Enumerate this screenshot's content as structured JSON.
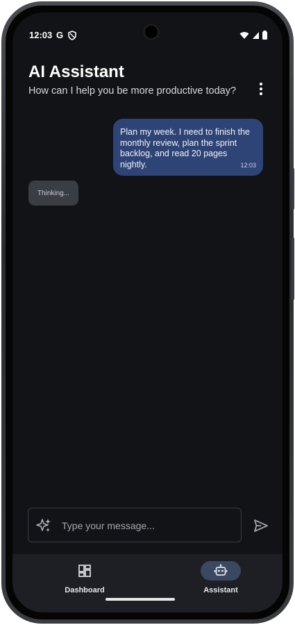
{
  "status_bar": {
    "time": "12:03",
    "google_glyph": "G"
  },
  "header": {
    "title": "AI Assistant",
    "subtitle": "How can I help you be more productive today?",
    "menu_icon": "more-vert-icon"
  },
  "messages": [
    {
      "role": "user",
      "text": "Plan my week. I need to finish the monthly review, plan the sprint backlog, and read 20 pages nightly.",
      "time": "12:03"
    },
    {
      "role": "assistant",
      "text": "Thinking..."
    }
  ],
  "composer": {
    "placeholder": "Type your message...",
    "value": ""
  },
  "nav": {
    "items": [
      {
        "label": "Dashboard",
        "icon": "dashboard-icon",
        "selected": false
      },
      {
        "label": "Assistant",
        "icon": "robot-icon",
        "selected": true
      }
    ]
  },
  "colors": {
    "background": "#121317",
    "user_bubble": "#2f4476",
    "thinking_bubble": "#3b3d44",
    "nav_bar": "#1d1f24",
    "nav_active_pill": "#3b4862"
  }
}
